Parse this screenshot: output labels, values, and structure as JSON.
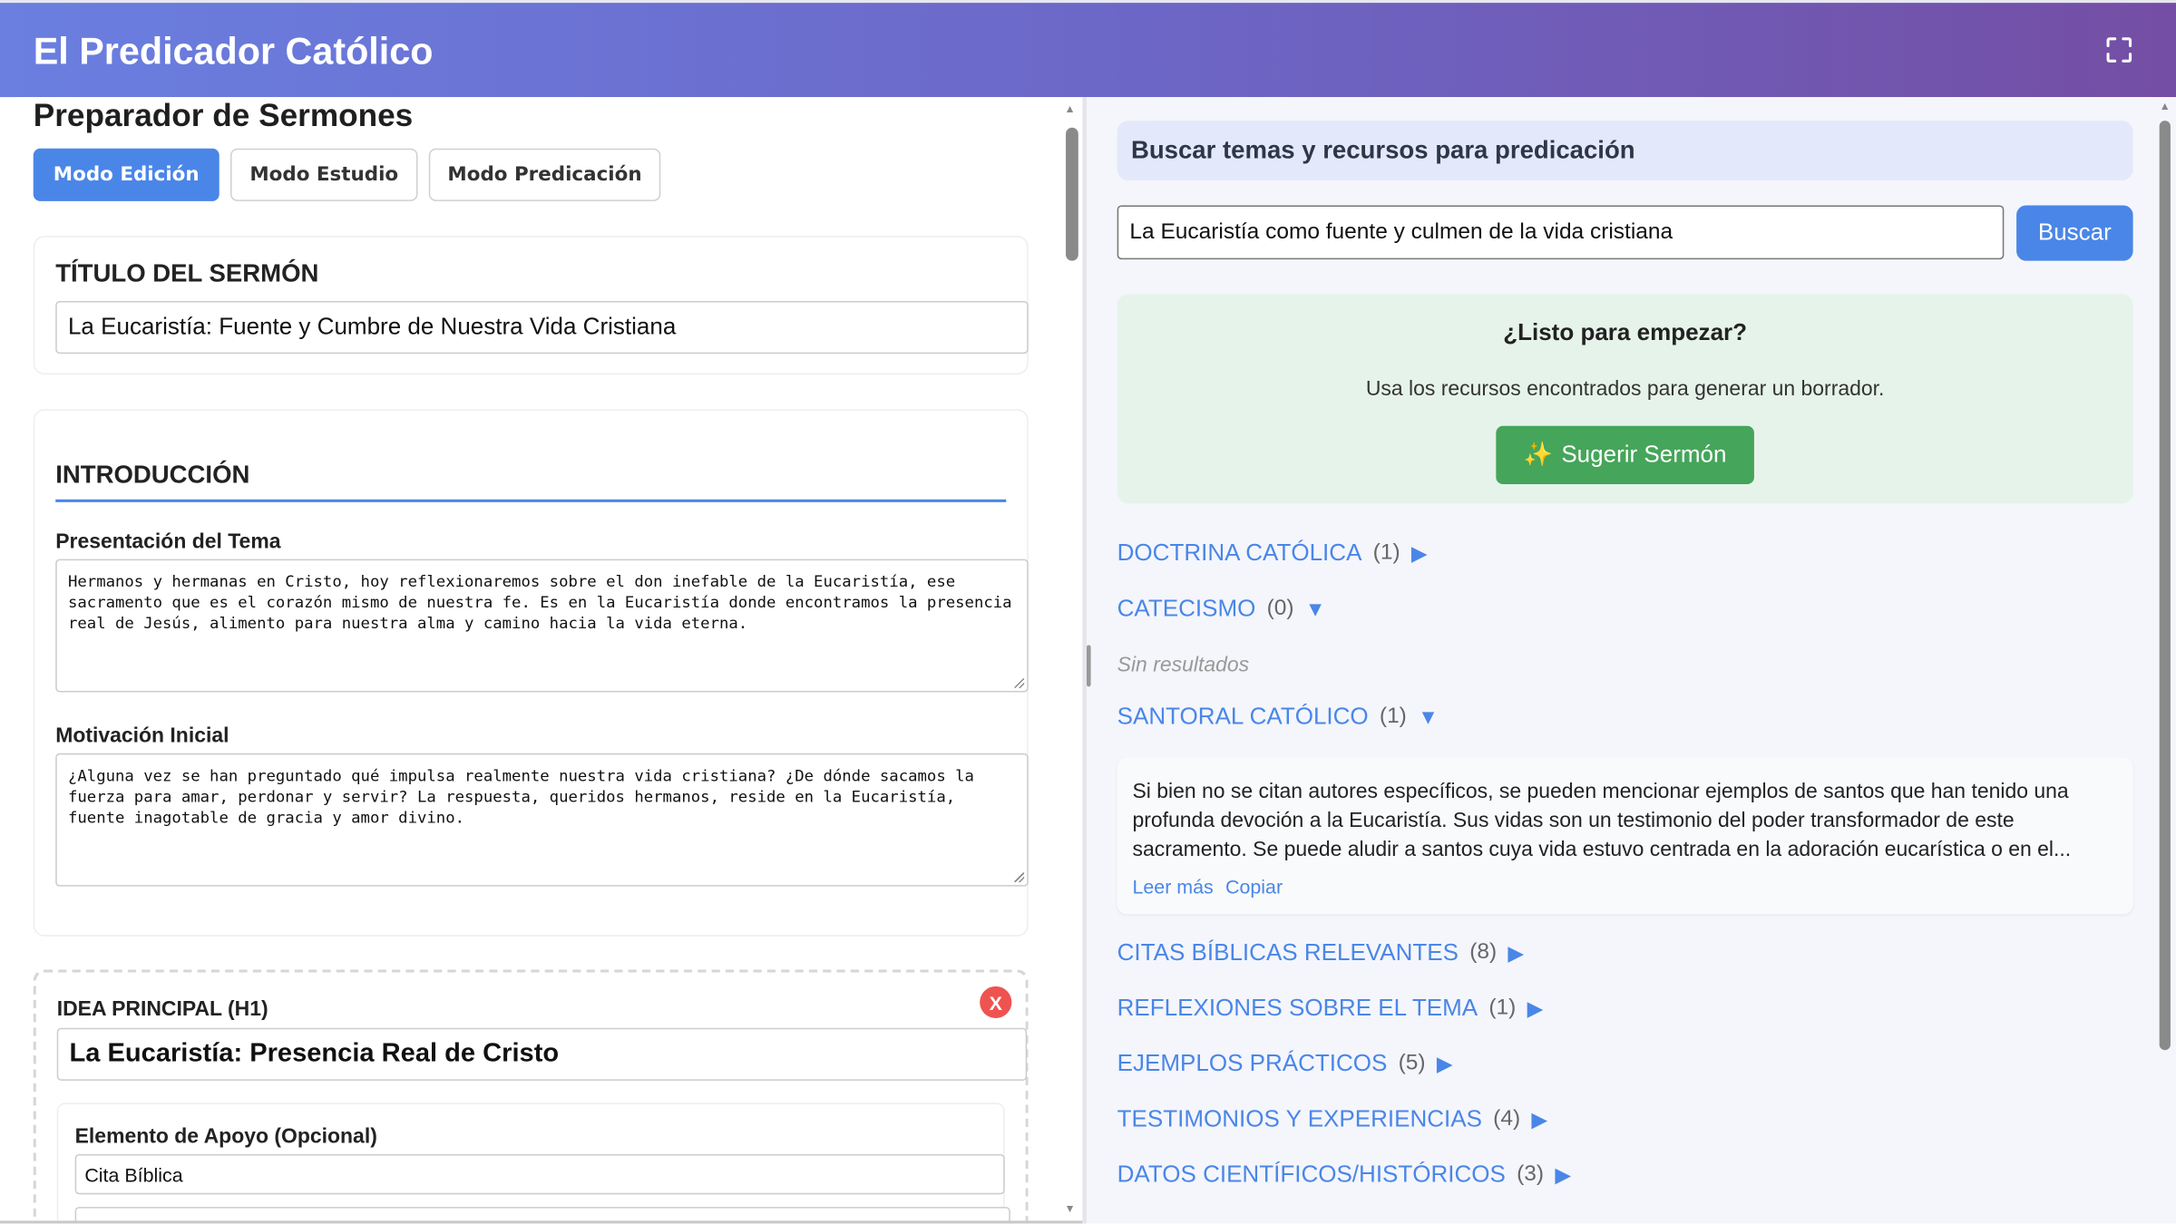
{
  "header": {
    "title": "El Predicador Católico"
  },
  "left": {
    "page_title": "Preparador de Sermones",
    "modes": [
      "Modo Edición",
      "Modo Estudio",
      "Modo Predicación"
    ],
    "title_section": {
      "heading": "TÍTULO DEL SERMÓN",
      "value": "La Eucaristía: Fuente y Cumbre de Nuestra Vida Cristiana"
    },
    "intro": {
      "heading": "INTRODUCCIÓN",
      "presentation_label": "Presentación del Tema",
      "presentation_text": "Hermanos y hermanas en Cristo, hoy reflexionaremos sobre el don inefable de la Eucaristía, ese sacramento que es el corazón mismo de nuestra fe. Es en la Eucaristía donde encontramos la presencia real de Jesús, alimento para nuestra alma y camino hacia la vida eterna.",
      "motivation_label": "Motivación Inicial",
      "motivation_text": "¿Alguna vez se han preguntado qué impulsa realmente nuestra vida cristiana? ¿De dónde sacamos la fuerza para amar, perdonar y servir? La respuesta, queridos hermanos, reside en la Eucaristía, fuente inagotable de gracia y amor divino."
    },
    "main_idea": {
      "heading": "IDEA PRINCIPAL (H1)",
      "remove_label": "X",
      "value": "La Eucaristía: Presencia Real de Cristo",
      "support_label": "Elemento de Apoyo (Opcional)",
      "support_type": "Cita Bíblica"
    }
  },
  "right": {
    "search_heading": "Buscar temas y recursos para predicación",
    "search_value": "La Eucaristía como fuente y culmen de la vida cristiana",
    "search_button": "Buscar",
    "ready": {
      "title": "¿Listo para empezar?",
      "text": "Usa los recursos encontrados para generar un borrador.",
      "button_icon": "✨",
      "button": "Sugerir Sermón"
    },
    "categories": [
      {
        "name": "DOCTRINA CATÓLICA",
        "count": "(1)",
        "arrow": "▶"
      },
      {
        "name": "CATECISMO",
        "count": "(0)",
        "arrow": "▼"
      },
      {
        "name": "SANTORAL CATÓLICO",
        "count": "(1)",
        "arrow": "▼"
      },
      {
        "name": "CITAS BÍBLICAS RELEVANTES",
        "count": "(8)",
        "arrow": "▶"
      },
      {
        "name": "REFLEXIONES SOBRE EL TEMA",
        "count": "(1)",
        "arrow": "▶"
      },
      {
        "name": "EJEMPLOS PRÁCTICOS",
        "count": "(5)",
        "arrow": "▶"
      },
      {
        "name": "TESTIMONIOS Y EXPERIENCIAS",
        "count": "(4)",
        "arrow": "▶"
      },
      {
        "name": "DATOS CIENTÍFICOS/HISTÓRICOS",
        "count": "(3)",
        "arrow": "▶"
      }
    ],
    "no_results": "Sin resultados",
    "santoral_result": {
      "text": "Si bien no se citan autores específicos, se pueden mencionar ejemplos de santos que han tenido una profunda devoción a la Eucaristía. Sus vidas son un testimonio del poder transformador de este sacramento. Se puede aludir a santos cuya vida estuvo centrada en la adoración eucarística o en el...",
      "read_more": "Leer más",
      "copy": "Copiar"
    }
  }
}
